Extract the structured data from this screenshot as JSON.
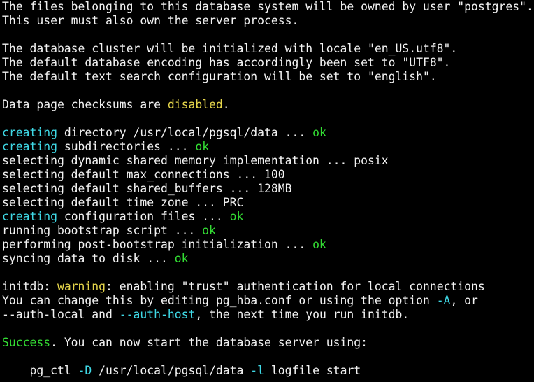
{
  "colors": {
    "background": "#000000",
    "text": "#f2f2f2",
    "keyword_cyan": "#3fd9e6",
    "ok_green": "#33dd33",
    "warning_yellow": "#e6d64b"
  },
  "terminal": {
    "lines": [
      {
        "segments": [
          {
            "text": "The files belonging to this database system will be owned by user \"postgres\"."
          }
        ]
      },
      {
        "segments": [
          {
            "text": "This user must also own the server process."
          }
        ]
      },
      {
        "segments": []
      },
      {
        "segments": [
          {
            "text": "The database cluster will be initialized with locale \"en_US.utf8\"."
          }
        ]
      },
      {
        "segments": [
          {
            "text": "The default database encoding has accordingly been set to \"UTF8\"."
          }
        ]
      },
      {
        "segments": [
          {
            "text": "The default text search configuration will be set to \"english\"."
          }
        ]
      },
      {
        "segments": []
      },
      {
        "segments": [
          {
            "text": "Data page checksums are "
          },
          {
            "text": "disabled",
            "style": "yellow"
          },
          {
            "text": "."
          }
        ]
      },
      {
        "segments": []
      },
      {
        "segments": [
          {
            "text": "creating",
            "style": "cyan"
          },
          {
            "text": " directory /usr/local/pgsql/data ... "
          },
          {
            "text": "ok",
            "style": "green"
          }
        ]
      },
      {
        "segments": [
          {
            "text": "creating",
            "style": "cyan"
          },
          {
            "text": " subdirectories ... "
          },
          {
            "text": "ok",
            "style": "green"
          }
        ]
      },
      {
        "segments": [
          {
            "text": "selecting dynamic shared memory implementation ... posix"
          }
        ]
      },
      {
        "segments": [
          {
            "text": "selecting default max_connections ... 100"
          }
        ]
      },
      {
        "segments": [
          {
            "text": "selecting default shared_buffers ... 128MB"
          }
        ]
      },
      {
        "segments": [
          {
            "text": "selecting default time zone ... PRC"
          }
        ]
      },
      {
        "segments": [
          {
            "text": "creating",
            "style": "cyan"
          },
          {
            "text": " configuration files ... "
          },
          {
            "text": "ok",
            "style": "green"
          }
        ]
      },
      {
        "segments": [
          {
            "text": "running bootstrap script ... "
          },
          {
            "text": "ok",
            "style": "green"
          }
        ]
      },
      {
        "segments": [
          {
            "text": "performing post-bootstrap initialization ... "
          },
          {
            "text": "ok",
            "style": "green"
          }
        ]
      },
      {
        "segments": [
          {
            "text": "syncing data to disk ... "
          },
          {
            "text": "ok",
            "style": "green"
          }
        ]
      },
      {
        "segments": []
      },
      {
        "segments": [
          {
            "text": "initdb: "
          },
          {
            "text": "warning",
            "style": "yellow"
          },
          {
            "text": ": enabling \"trust\" authentication for local connections"
          }
        ]
      },
      {
        "segments": [
          {
            "text": "You can change this by editing pg_hba.conf or using the option "
          },
          {
            "text": "-A",
            "style": "cyan"
          },
          {
            "text": ", or"
          }
        ]
      },
      {
        "segments": [
          {
            "text": "--auth-local and "
          },
          {
            "text": "--auth-host",
            "style": "cyan"
          },
          {
            "text": ", the next time you run initdb."
          }
        ]
      },
      {
        "segments": []
      },
      {
        "segments": [
          {
            "text": "Success",
            "style": "green"
          },
          {
            "text": ". You can now start the database server using:"
          }
        ]
      },
      {
        "segments": []
      },
      {
        "segments": [
          {
            "text": "    pg_ctl "
          },
          {
            "text": "-D",
            "style": "cyan"
          },
          {
            "text": " /usr/local/pgsql/data "
          },
          {
            "text": "-l",
            "style": "cyan"
          },
          {
            "text": " logfile start"
          }
        ]
      }
    ]
  }
}
